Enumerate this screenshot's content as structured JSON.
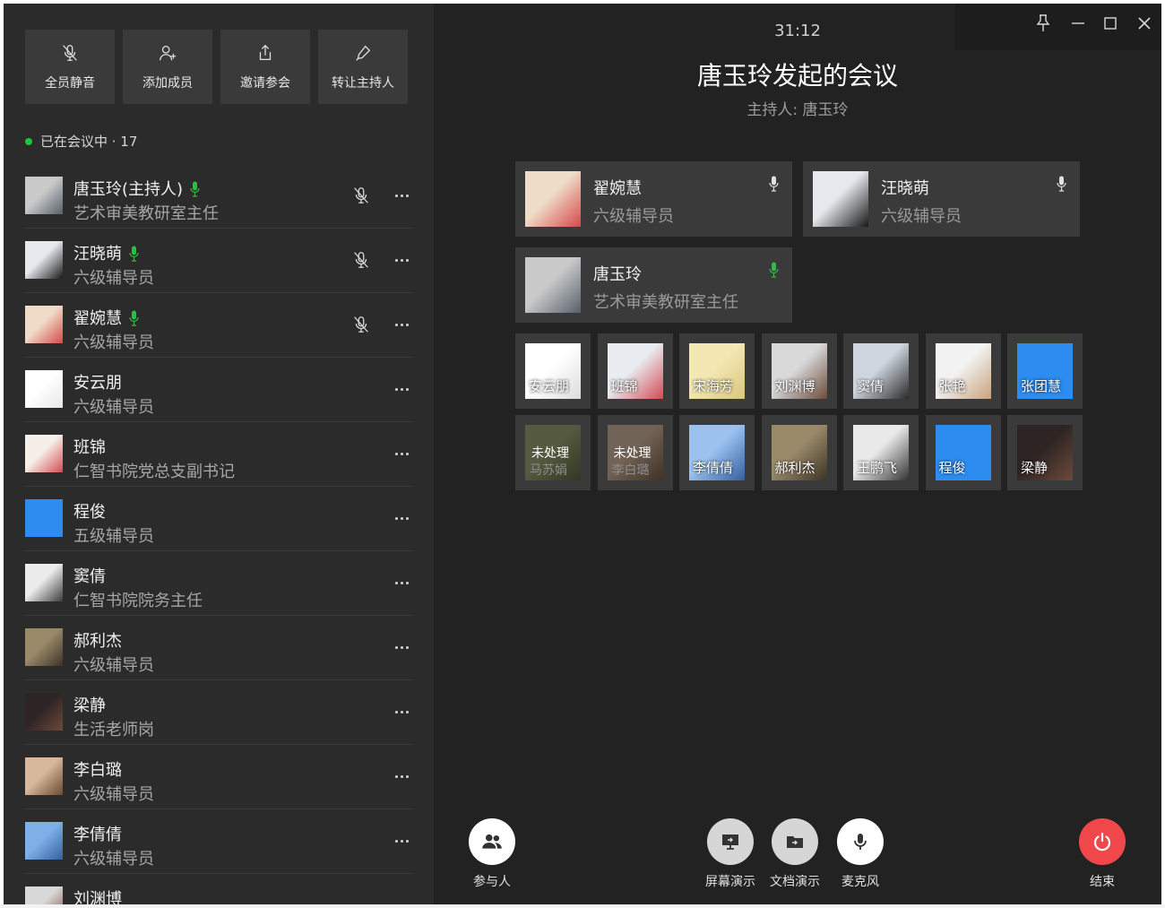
{
  "colors": {
    "left_bg": "#2b2b2b",
    "right_bg": "#222222",
    "card_bg": "#3a3a3a",
    "speaking_mic": "#1ec53c",
    "end_button": "#f0484a"
  },
  "actions": [
    {
      "label": "全员静音",
      "icon": "mic-off-icon"
    },
    {
      "label": "添加成员",
      "icon": "add-user-icon"
    },
    {
      "label": "邀请参会",
      "icon": "share-icon"
    },
    {
      "label": "转让主持人",
      "icon": "pen-icon"
    }
  ],
  "status": {
    "text": "已在会议中 · 17"
  },
  "participants": [
    {
      "name": "唐玉玲(主持人)",
      "role": "艺术审美教研室主任",
      "speaking": true,
      "muted_icon": true,
      "avatar": [
        "#c9c9c9",
        "#56606a"
      ]
    },
    {
      "name": "汪晓萌",
      "role": "六级辅导员",
      "speaking": true,
      "muted_icon": true,
      "avatar": [
        "#e5e8ec",
        "#181818"
      ]
    },
    {
      "name": "翟婉慧",
      "role": "六级辅导员",
      "speaking": true,
      "muted_icon": true,
      "avatar": [
        "#efdcc7",
        "#d6484a"
      ]
    },
    {
      "name": "安云朋",
      "role": "六级辅导员",
      "speaking": false,
      "muted_icon": false,
      "avatar": [
        "#ffffff",
        "#e6e6e6"
      ]
    },
    {
      "name": "班锦",
      "role": "仁智书院党总支副书记",
      "speaking": false,
      "muted_icon": false,
      "avatar": [
        "#f6efe8",
        "#d44a52"
      ]
    },
    {
      "name": "程俊",
      "role": "五级辅导员",
      "speaking": false,
      "muted_icon": false,
      "avatar": [
        "#2d8cf0",
        "#2d8cf0"
      ]
    },
    {
      "name": "窦倩",
      "role": "仁智书院院务主任",
      "speaking": false,
      "muted_icon": false,
      "avatar": [
        "#ececec",
        "#3b3b3b"
      ]
    },
    {
      "name": "郝利杰",
      "role": "六级辅导员",
      "speaking": false,
      "muted_icon": false,
      "avatar": [
        "#9a8a6a",
        "#3b3326"
      ]
    },
    {
      "name": "梁静",
      "role": "生活老师岗",
      "speaking": false,
      "muted_icon": false,
      "avatar": [
        "#2e2424",
        "#6c4a3a"
      ]
    },
    {
      "name": "李白璐",
      "role": "六级辅导员",
      "speaking": false,
      "muted_icon": false,
      "avatar": [
        "#d8b89a",
        "#6a4a30"
      ]
    },
    {
      "name": "李倩倩",
      "role": "六级辅导员",
      "speaking": false,
      "muted_icon": false,
      "avatar": [
        "#7fb0e8",
        "#355fa0"
      ]
    },
    {
      "name": "刘渊博",
      "role": "",
      "speaking": false,
      "muted_icon": false,
      "avatar": [
        "#d8d8d8",
        "#7a4a3a"
      ]
    }
  ],
  "meeting": {
    "timer": "31:12",
    "title": "唐玉玲发起的会议",
    "host": "主持人: 唐玉玲"
  },
  "speakers": [
    {
      "name": "翟婉慧",
      "role": "六级辅导员",
      "mic_active": false,
      "avatar": [
        "#efdcc7",
        "#d6484a"
      ]
    },
    {
      "name": "汪晓萌",
      "role": "六级辅导员",
      "mic_active": false,
      "avatar": [
        "#e5e8ec",
        "#181818"
      ]
    },
    {
      "name": "唐玉玲",
      "role": "艺术审美教研室主任",
      "mic_active": true,
      "avatar": [
        "#c9c9c9",
        "#56606a"
      ]
    }
  ],
  "tiles": [
    {
      "name": "安云朋",
      "pending": false,
      "avatar": [
        "#ffffff",
        "#dcdcdc"
      ]
    },
    {
      "name": "班锦",
      "pending": false,
      "avatar": [
        "#e9edf2",
        "#d44a52"
      ]
    },
    {
      "name": "宋海芳",
      "pending": false,
      "avatar": [
        "#f3e7b3",
        "#d9c67c"
      ]
    },
    {
      "name": "刘渊博",
      "pending": false,
      "avatar": [
        "#d9d9d9",
        "#6a4a3a"
      ]
    },
    {
      "name": "窦倩",
      "pending": false,
      "avatar": [
        "#cfd6e0",
        "#2a2a2a"
      ]
    },
    {
      "name": "张艳",
      "pending": false,
      "avatar": [
        "#f2f2f2",
        "#c9a27a"
      ]
    },
    {
      "name": "张团慧",
      "pending": false,
      "avatar": [
        "#2d8cf0",
        "#2d8cf0"
      ]
    },
    {
      "name": "马苏娟",
      "pending": true,
      "pending_label": "未处理",
      "avatar": [
        "#9aa46a",
        "#4a5a2a"
      ]
    },
    {
      "name": "李白璐",
      "pending": true,
      "pending_label": "未处理",
      "avatar": [
        "#d8b89a",
        "#6a4a30"
      ]
    },
    {
      "name": "李倩倩",
      "pending": false,
      "avatar": [
        "#9bc2ef",
        "#355fa0"
      ]
    },
    {
      "name": "郝利杰",
      "pending": false,
      "avatar": [
        "#9a8a6a",
        "#3b3326"
      ]
    },
    {
      "name": "王鹏飞",
      "pending": false,
      "avatar": [
        "#e9e9e9",
        "#333333"
      ]
    },
    {
      "name": "程俊",
      "pending": false,
      "avatar": [
        "#2d8cf0",
        "#2d8cf0"
      ]
    },
    {
      "name": "梁静",
      "pending": false,
      "avatar": [
        "#2e2424",
        "#6c4a3a"
      ]
    }
  ],
  "controls": {
    "participants": "参与人",
    "screen_share": "屏幕演示",
    "doc_share": "文档演示",
    "mic": "麦克风",
    "end": "结束"
  }
}
